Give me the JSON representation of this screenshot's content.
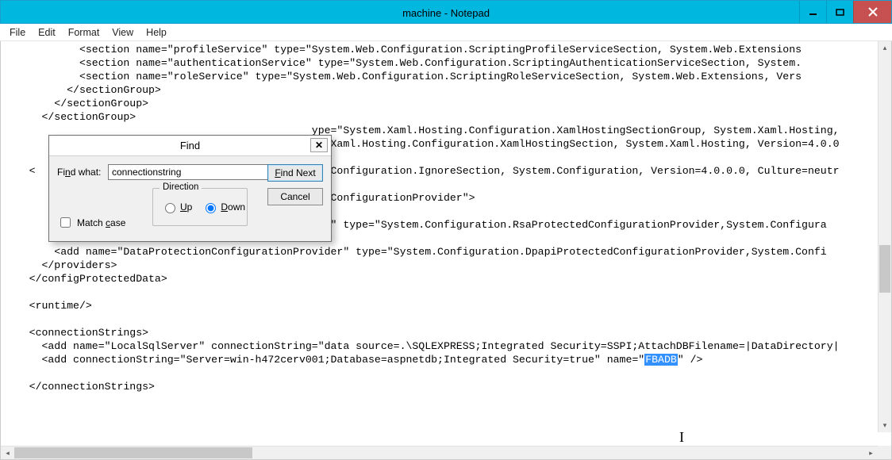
{
  "window": {
    "title": "machine - Notepad"
  },
  "menu": {
    "file": "File",
    "edit": "Edit",
    "format": "Format",
    "view": "View",
    "help": "Help"
  },
  "editor": {
    "lines": [
      "            <section name=\"profileService\" type=\"System.Web.Configuration.ScriptingProfileServiceSection, System.Web.Extensions",
      "            <section name=\"authenticationService\" type=\"System.Web.Configuration.ScriptingAuthenticationServiceSection, System.",
      "            <section name=\"roleService\" type=\"System.Web.Configuration.ScriptingRoleServiceSection, System.Web.Extensions, Vers",
      "          </sectionGroup>",
      "        </sectionGroup>",
      "      </sectionGroup>",
      "                                                 ype=\"System.Xaml.Hosting.Configuration.XamlHostingSectionGroup, System.Xaml.Hosting,",
      "                                                 em.Xaml.Hosting.Configuration.XamlHostingSection, System.Xaml.Hosting, Version=4.0.0",
      "",
      "    <                                            em.Configuration.IgnoreSection, System.Configuration, Version=4.0.0.0, Culture=neutr",
      "",
      "                                                 tedConfigurationProvider\">",
      "",
      "        <add name=\"RsaProtectedConfigurationProvider\" type=\"System.Configuration.RsaProtectedConfigurationProvider,System.Configura",
      "",
      "        <add name=\"DataProtectionConfigurationProvider\" type=\"System.Configuration.DpapiProtectedConfigurationProvider,System.Confi",
      "      </providers>",
      "    </configProtectedData>",
      "",
      "    <runtime/>",
      "",
      "    <connectionStrings>",
      "      <add name=\"LocalSqlServer\" connectionString=\"data source=.\\SQLEXPRESS;Integrated Security=SSPI;AttachDBFilename=|DataDirectory|",
      "      <add connectionString=\"Server=win-h472cerv001;Database=aspnetdb;Integrated Security=true\" name=\""
    ],
    "highlight_after_line23": "FBADB",
    "after_highlight": "\" />",
    "closing": "    </connectionStrings>"
  },
  "find": {
    "title": "Find",
    "label": "Find what:",
    "value": "connectionstring",
    "find_next": "Find Next",
    "cancel": "Cancel",
    "direction_label": "Direction",
    "up": "Up",
    "down": "Down",
    "matchcase": "Match case",
    "direction_selected": "down",
    "match_case_checked": false
  }
}
